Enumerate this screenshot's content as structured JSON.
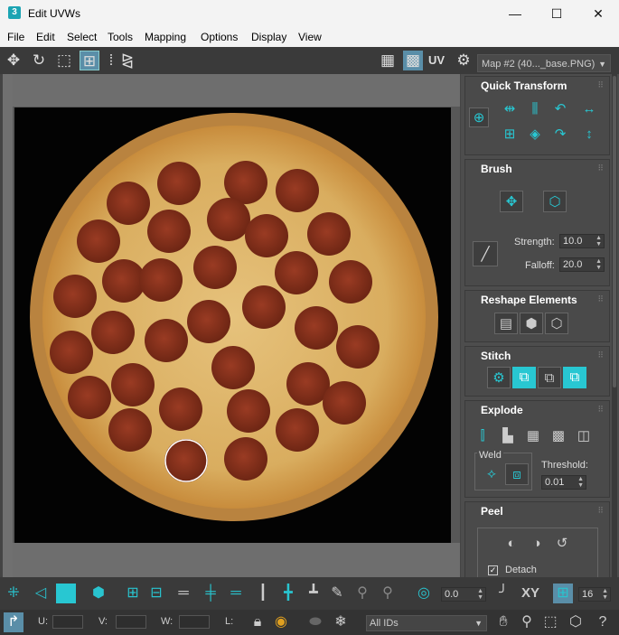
{
  "window": {
    "title": "Edit UVWs",
    "app_badge": "3",
    "minimize": "—",
    "maximize": "☐",
    "close": "✕"
  },
  "menu": [
    "File",
    "Edit",
    "Select",
    "Tools",
    "Mapping",
    "Options",
    "Display",
    "View"
  ],
  "toolbar": {
    "uv_label": "UV",
    "map_select": "Map #2 (40..._base.PNG)"
  },
  "panel": {
    "quick_transform": {
      "title": "Quick Transform"
    },
    "brush": {
      "title": "Brush",
      "strength_label": "Strength:",
      "strength_value": "10.0",
      "falloff_label": "Falloff:",
      "falloff_value": "20.0"
    },
    "reshape": {
      "title": "Reshape Elements"
    },
    "stitch": {
      "title": "Stitch"
    },
    "explode": {
      "title": "Explode",
      "weld_label": "Weld",
      "threshold_label": "Threshold:",
      "threshold_value": "0.01"
    },
    "peel": {
      "title": "Peel",
      "detach_label": "Detach",
      "detach_checked": true
    }
  },
  "bottom": {
    "spin_value": "0.0",
    "xy_label": "XY",
    "grid_value": "16",
    "u_label": "U:",
    "v_label": "V:",
    "w_label": "W:",
    "l_label": "L:",
    "ids_select": "All IDs"
  },
  "colors": {
    "accent": "#28c7d2",
    "panel_bg": "#4a4a4a",
    "canvas_bg": "#030303",
    "cheese": "#d9b46a",
    "pepperoni": "#8a3521",
    "crust": "#c9924a"
  }
}
